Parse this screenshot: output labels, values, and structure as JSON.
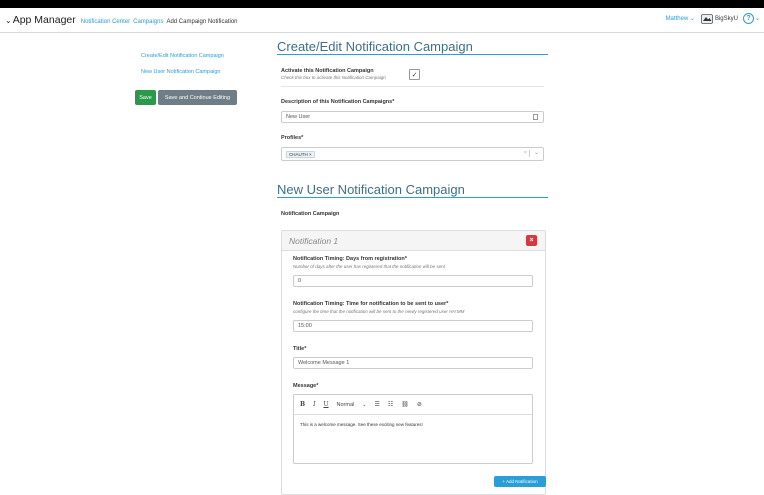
{
  "header": {
    "app_title": "App Manager",
    "app_caret": "⌄",
    "breadcrumbs": [
      "Notification Center",
      "Campaigns"
    ],
    "current": "Add Campaign Notification",
    "user": "Matthew",
    "user_caret": "⌄",
    "org": "BigSkyU",
    "help": "?",
    "help_caret": "⌄"
  },
  "sidebar": {
    "items": [
      {
        "label": "Create/Edit Notification Campaign"
      },
      {
        "label": "New User Notification Campaign"
      }
    ],
    "save_label": "Save",
    "save_continue_label": "Save and Continue Editing"
  },
  "campaign": {
    "title": "Create/Edit Notification Campaign",
    "activate_label": "Activate this Notification Campaign",
    "activate_hint": "Check this box to activate this Notification Campaign",
    "activate_checked": true,
    "activate_check_glyph": "✓",
    "description_label": "Description of this Notification Campaigns*",
    "description_value": "New User",
    "profiles_label": "Profiles*",
    "profiles_tag": "CHAUTH",
    "profiles_tag_remove": "×",
    "profiles_clear": "×",
    "profiles_chevron": "⌄"
  },
  "new_user": {
    "title": "New User Notification Campaign",
    "section_label": "Notification Campaign",
    "notification": {
      "title": "Notification 1",
      "remove_glyph": "×",
      "days_label": "Notification Timing: Days from registration*",
      "days_hint": "Number of days after the user has registered that the notification will be sent",
      "days_value": "0",
      "time_label": "Notification Timing: Time for notification to be sent to user*",
      "time_hint": "configure the time that the notification will be sent to the newly registered user HH:MM",
      "time_value": "15:00",
      "title_label": "Title*",
      "title_value": "Welcome Message 1",
      "message_label": "Message*",
      "message_body": "This is a welcome message. See these exciting new features!",
      "toolbar": {
        "bold": "B",
        "italic": "I",
        "underline": "U",
        "format": "Normal",
        "format_chevron": "⌄",
        "ordered_list": "☰",
        "bullet_list": "☷",
        "link": "⛓",
        "clear_format": "⊘"
      }
    },
    "add_label": "+ Add Notification"
  },
  "colors": {
    "accent": "#2a9ed6",
    "title": "#3b7086",
    "save": "#2a9a4a",
    "secondary": "#6f7d86",
    "danger": "#d9363e"
  }
}
